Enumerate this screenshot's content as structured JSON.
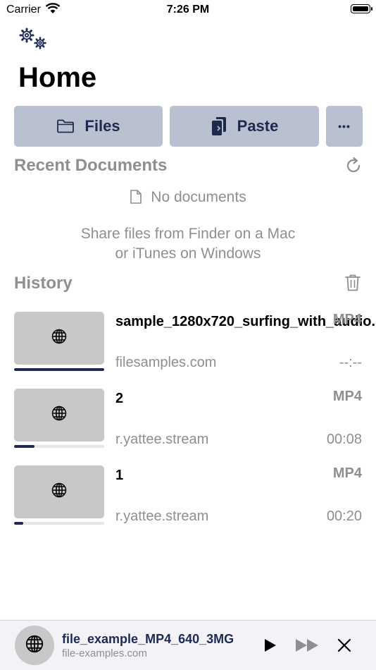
{
  "status_bar": {
    "carrier": "Carrier",
    "time": "7:26 PM"
  },
  "header": {
    "title": "Home"
  },
  "actions": {
    "files_label": "Files",
    "paste_label": "Paste",
    "more_label": "•••"
  },
  "recent": {
    "title": "Recent Documents",
    "empty_label": "No documents",
    "hint_line1": "Share files from Finder on a Mac",
    "hint_line2": "or iTunes on Windows"
  },
  "history": {
    "title": "History",
    "items": [
      {
        "title": "sample_1280x720_surfing_with_audio...",
        "format": "MP4",
        "source": "filesamples.com",
        "time": "--:--",
        "progress": 1.0
      },
      {
        "title": "2",
        "format": "MP4",
        "source": "r.yattee.stream",
        "time": "00:08",
        "progress": 0.23
      },
      {
        "title": "1",
        "format": "MP4",
        "source": "r.yattee.stream",
        "time": "00:20",
        "progress": 0.1
      }
    ]
  },
  "player": {
    "title": "file_example_MP4_640_3MG",
    "source": "file-examples.com"
  },
  "colors": {
    "accent": "#1e2a55",
    "button_bg": "#b9c0cf",
    "secondary_text": "#8e8e93"
  },
  "icons": [
    "wifi-icon",
    "battery-icon",
    "gear-icon",
    "folder-icon",
    "paste-icon",
    "refresh-icon",
    "document-icon",
    "trash-icon",
    "globe-icon",
    "play-icon",
    "fast-forward-icon",
    "close-icon"
  ]
}
